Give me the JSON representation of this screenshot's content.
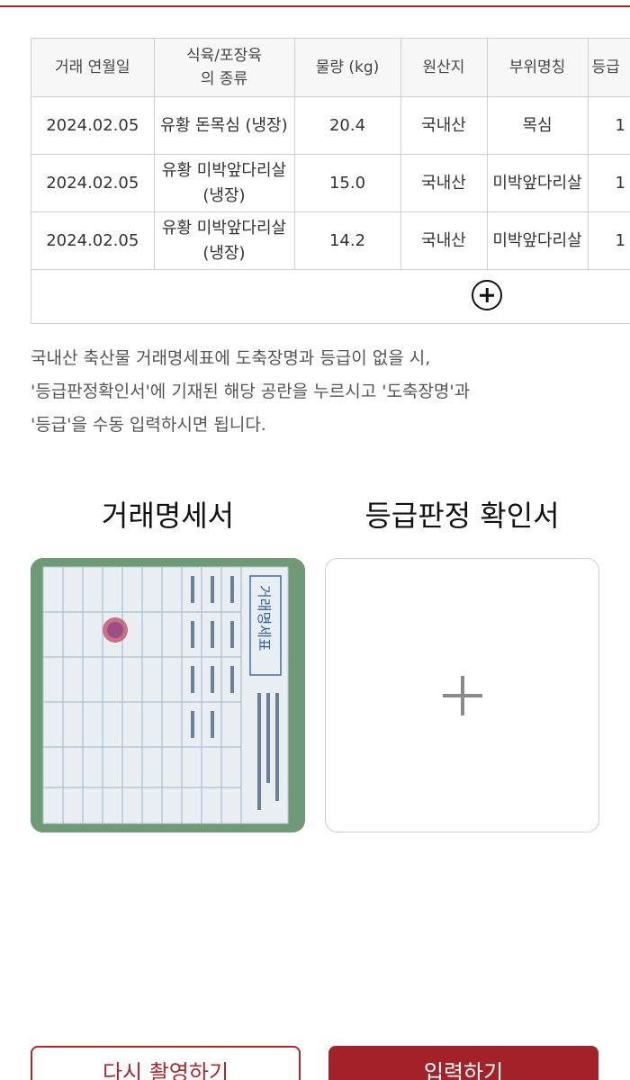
{
  "table": {
    "headers": [
      "거래 연월일",
      "식육/포장육\n의 종류",
      "물량 (kg)",
      "원산지",
      "부위명칭",
      "등급"
    ],
    "rows": [
      [
        "2024.02.05",
        "유황 돈목심 (냉장)",
        "20.4",
        "국내산",
        "목심",
        "1"
      ],
      [
        "2024.02.05",
        "유황 미박앞다리살 (냉장)",
        "15.0",
        "국내산",
        "미박앞다리살",
        "1"
      ],
      [
        "2024.02.05",
        "유황 미박앞다리살 (냉장)",
        "14.2",
        "국내산",
        "미박앞다리살",
        "1"
      ]
    ],
    "add_row_icon": "plus-circle-icon"
  },
  "notice": {
    "line1": "국내산 축산물 거래명세표에 도축장명과 등급이 없을 시,",
    "line2": "'등급판정확인서'에 기재된 해당 공란을 누르시고 '도축장명'과",
    "line3": "'등급'을 수동 입력하시면 됩니다."
  },
  "documents": {
    "invoice_title": "거래명세서",
    "grade_title": "등급판정 확인서",
    "upload_icon": "plus-icon"
  },
  "photo_doc": {
    "heading": "거래명세표"
  },
  "buttons": {
    "retake": "다시 촬영하기",
    "submit": "입력하기"
  },
  "colors": {
    "accent": "#a3222a",
    "border": "#cfcfcf",
    "header_bg": "#f7f7f7"
  }
}
